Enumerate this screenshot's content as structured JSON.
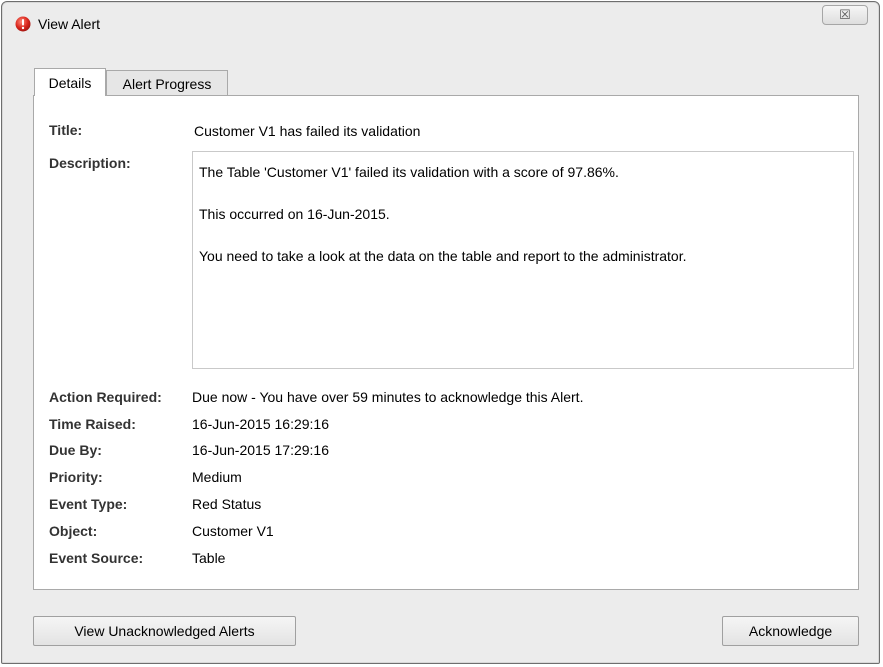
{
  "window": {
    "title": "View Alert",
    "close_glyph": "☒"
  },
  "tabs": [
    {
      "label": "Details"
    },
    {
      "label": "Alert Progress"
    }
  ],
  "details": {
    "title_label": "Title:",
    "title_value": "Customer V1 has failed its validation",
    "description_label": "Description:",
    "description_lines": [
      "The Table 'Customer V1' failed its validation with a score of 97.86%.",
      "This occurred on 16-Jun-2015.",
      "You need to take a look at the data on the table and report to the administrator."
    ],
    "action_required_label": "Action Required:",
    "action_required_value": "Due now - You have over 59 minutes to acknowledge this Alert.",
    "time_raised_label": "Time Raised:",
    "time_raised_value": "16-Jun-2015 16:29:16",
    "due_by_label": "Due By:",
    "due_by_value": "16-Jun-2015 17:29:16",
    "priority_label": "Priority:",
    "priority_value": "Medium",
    "event_type_label": "Event Type:",
    "event_type_value": "Red Status",
    "object_label": "Object:",
    "object_value": "Customer V1",
    "event_source_label": "Event Source:",
    "event_source_value": "Table"
  },
  "buttons": {
    "view_unacknowledged": "View Unacknowledged Alerts",
    "acknowledge": "Acknowledge"
  },
  "icons": {
    "title_icon": "alert-icon",
    "close": "close-icon"
  },
  "colors": {
    "alert_red": "#d9261c",
    "window_bg": "#ececec",
    "panel_bg": "#ffffff"
  }
}
